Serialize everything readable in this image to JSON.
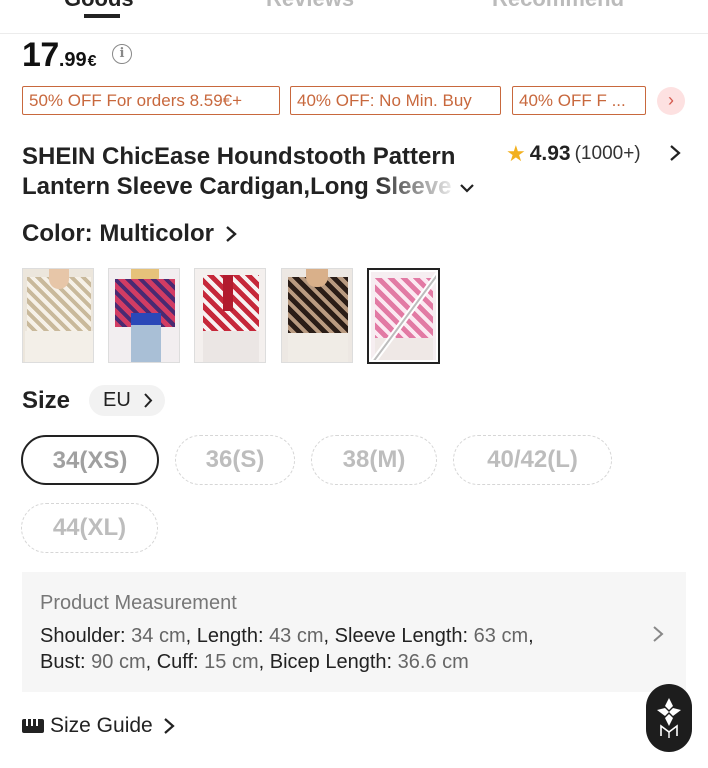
{
  "tabs": [
    {
      "label": "Goods",
      "active": true
    },
    {
      "label": "Reviews",
      "active": false
    },
    {
      "label": "Recommend",
      "active": false
    }
  ],
  "price": {
    "integer": "17",
    "decimal": ".99",
    "currency": "€"
  },
  "promos": [
    "50% OFF For orders 8.59€+",
    "40% OFF: No Min. Buy",
    "40% OFF F ..."
  ],
  "product": {
    "title_line1": "SHEIN ChicEase Houndstooth Pattern",
    "title_line2": "Lantern Sleeve Cardigan,Long Sleeve"
  },
  "rating": {
    "value": "4.93",
    "count": "(1000+)"
  },
  "color": {
    "label": "Color: Multicolor",
    "swatch_count": 5,
    "selected_index": 4
  },
  "size": {
    "label": "Size",
    "region": "EU",
    "options": [
      "34(XS)",
      "36(S)",
      "38(M)",
      "40/42(L)",
      "44(XL)"
    ],
    "selected": "34(XS)"
  },
  "measurement": {
    "title": "Product Measurement",
    "shoulder_label": "Shoulder: ",
    "shoulder": "34 cm",
    "length_label": "Length: ",
    "length": "43 cm",
    "sleeve_label": "Sleeve Length: ",
    "sleeve": "63 cm",
    "bust_label": "Bust: ",
    "bust": "90 cm",
    "cuff_label": "Cuff: ",
    "cuff": "15 cm",
    "bicep_label": "Bicep Length: ",
    "bicep": "36.6 cm"
  },
  "size_guide": {
    "label": "Size Guide"
  },
  "colors": {
    "promo": "#c8683d",
    "star": "#f2b01e",
    "fab": "#1d1d1d"
  }
}
